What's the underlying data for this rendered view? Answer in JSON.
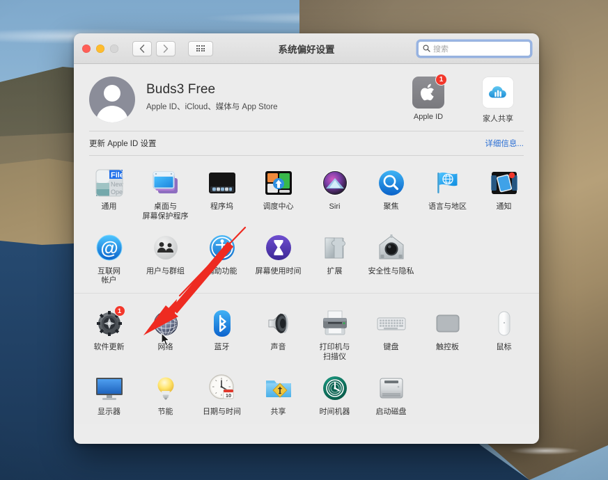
{
  "window": {
    "title": "系统偏好设置",
    "traffic_lights": {
      "close": "close-button",
      "minimize": "minimize-button",
      "zoom": "zoom-button"
    },
    "nav": {
      "back": "back-button",
      "forward": "forward-button",
      "grid": "show-all-button"
    },
    "search": {
      "placeholder": "搜索",
      "value": ""
    }
  },
  "account": {
    "name": "Buds3 Free",
    "subtitle": "Apple ID、iCloud、媒体与 App Store",
    "actions": [
      {
        "label": "Apple ID",
        "badge": "1"
      },
      {
        "label": "家人共享",
        "badge": ""
      }
    ]
  },
  "update_notice": {
    "text": "更新 Apple ID 设置",
    "link": "详细信息..."
  },
  "sections": [
    {
      "id": "personal",
      "items": [
        {
          "label": "通用",
          "icon": "general-icon",
          "badge": ""
        },
        {
          "label": "桌面与\n屏幕保护程序",
          "icon": "desktop-screensaver-icon",
          "badge": ""
        },
        {
          "label": "程序坞",
          "icon": "dock-icon",
          "badge": ""
        },
        {
          "label": "调度中心",
          "icon": "mission-control-icon",
          "badge": ""
        },
        {
          "label": "Siri",
          "icon": "siri-icon",
          "badge": ""
        },
        {
          "label": "聚焦",
          "icon": "spotlight-icon",
          "badge": ""
        },
        {
          "label": "语言与地区",
          "icon": "language-region-icon",
          "badge": ""
        },
        {
          "label": "通知",
          "icon": "notifications-icon",
          "badge": ""
        },
        {
          "label": "互联网\n帐户",
          "icon": "internet-accounts-icon",
          "badge": ""
        },
        {
          "label": "用户与群组",
          "icon": "users-groups-icon",
          "badge": ""
        },
        {
          "label": "辅助功能",
          "icon": "accessibility-icon",
          "badge": ""
        },
        {
          "label": "屏幕使用时间",
          "icon": "screen-time-icon",
          "badge": ""
        },
        {
          "label": "扩展",
          "icon": "extensions-icon",
          "badge": ""
        },
        {
          "label": "安全性与隐私",
          "icon": "security-privacy-icon",
          "badge": ""
        }
      ]
    },
    {
      "id": "hardware",
      "items": [
        {
          "label": "软件更新",
          "icon": "software-update-icon",
          "badge": "1"
        },
        {
          "label": "网络",
          "icon": "network-icon",
          "badge": ""
        },
        {
          "label": "蓝牙",
          "icon": "bluetooth-icon",
          "badge": ""
        },
        {
          "label": "声音",
          "icon": "sound-icon",
          "badge": ""
        },
        {
          "label": "打印机与\n扫描仪",
          "icon": "printers-scanners-icon",
          "badge": ""
        },
        {
          "label": "键盘",
          "icon": "keyboard-icon",
          "badge": ""
        },
        {
          "label": "触控板",
          "icon": "trackpad-icon",
          "badge": ""
        },
        {
          "label": "鼠标",
          "icon": "mouse-icon",
          "badge": ""
        },
        {
          "label": "显示器",
          "icon": "displays-icon",
          "badge": ""
        },
        {
          "label": "节能",
          "icon": "energy-saver-icon",
          "badge": ""
        },
        {
          "label": "日期与时间",
          "icon": "date-time-icon",
          "badge": ""
        },
        {
          "label": "共享",
          "icon": "sharing-icon",
          "badge": ""
        },
        {
          "label": "时间机器",
          "icon": "time-machine-icon",
          "badge": ""
        },
        {
          "label": "启动磁盘",
          "icon": "startup-disk-icon",
          "badge": ""
        }
      ]
    }
  ],
  "annotation": {
    "arrow_color": "#ee2b21",
    "points_to": "网络"
  }
}
